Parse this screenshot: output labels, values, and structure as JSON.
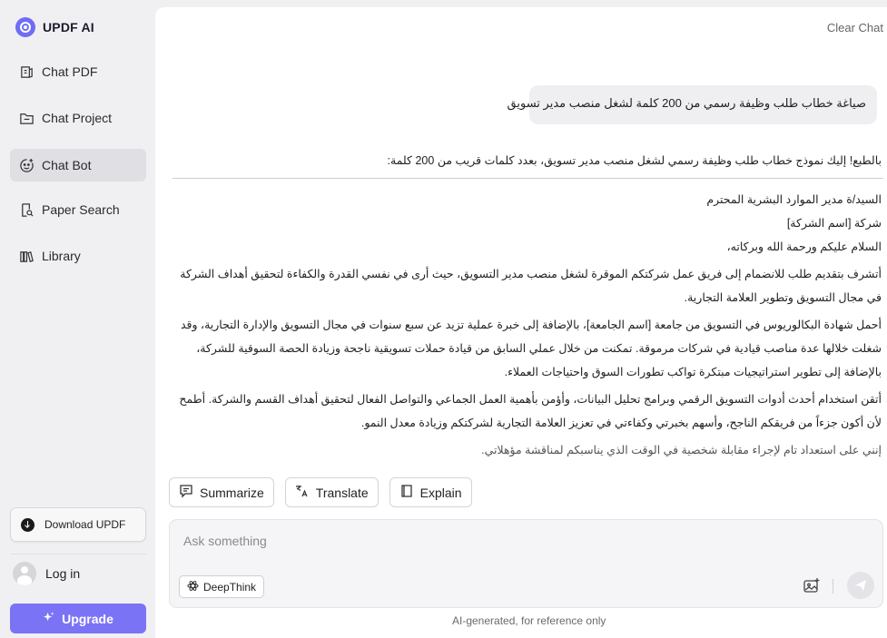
{
  "app": {
    "name": "UPDF AI"
  },
  "sidebar": {
    "items": [
      {
        "label": "Chat PDF",
        "icon": "chat-pdf-icon"
      },
      {
        "label": "Chat Project",
        "icon": "folder-icon"
      },
      {
        "label": "Chat Bot",
        "icon": "bot-icon",
        "active": true
      },
      {
        "label": "Paper Search",
        "icon": "paper-search-icon"
      },
      {
        "label": "Library",
        "icon": "library-icon"
      }
    ],
    "download_label": "Download UPDF",
    "login_label": "Log in",
    "upgrade_label": "Upgrade"
  },
  "header": {
    "clear_chat": "Clear Chat"
  },
  "conversation": {
    "user_message": "صياغة خطاب طلب وظيفة رسمي من 200 كلمة لشغل منصب مدير تسويق",
    "reply_intro": "بالطبع! إليك نموذج خطاب طلب وظيفة رسمي لشغل منصب مدير تسويق، بعدد كلمات قريب من 200 كلمة:",
    "reply_lines": {
      "salutation1": "السيد/ة مدير الموارد البشرية المحترم",
      "salutation2": "شركة [اسم الشركة]",
      "greeting": "السلام عليكم ورحمة الله وبركاته،",
      "para1": "أتشرف بتقديم طلب للانضمام إلى فريق عمل شركتكم الموقرة لشغل منصب مدير التسويق، حيث أرى في نفسي القدرة والكفاءة لتحقيق أهداف الشركة في مجال التسويق وتطوير العلامة التجارية.",
      "para2": "أحمل شهادة البكالوريوس في التسويق من جامعة [اسم الجامعة]، بالإضافة إلى خبرة عملية تزيد عن سبع سنوات في مجال التسويق والإدارة التجارية، وقد شغلت خلالها عدة مناصب قيادية في شركات مرموقة. تمكنت من خلال عملي السابق من قيادة حملات تسويقية ناجحة وزيادة الحصة السوقية للشركة، بالإضافة إلى تطوير استراتيجيات مبتكرة تواكب تطورات السوق واحتياجات العملاء.",
      "para3": "أتقن استخدام أحدث أدوات التسويق الرقمي وبرامج تحليل البيانات، وأؤمن بأهمية العمل الجماعي والتواصل الفعال لتحقيق أهداف القسم والشركة. أطمح لأن أكون جزءاً من فريقكم الناجح، وأسهم بخبرتي وكفاءتي في تعزيز العلامة التجارية لشركتكم وزيادة معدل النمو.",
      "para4_partial": "إنني على استعداد تام لإجراء مقابلة شخصية في الوقت الذي يناسبكم لمناقشة مؤهلاتي."
    }
  },
  "actions": {
    "summarize": "Summarize",
    "translate": "Translate",
    "explain": "Explain"
  },
  "composer": {
    "placeholder": "Ask something",
    "deepthink": "DeepThink"
  },
  "footer": {
    "note": "AI-generated, for reference only"
  },
  "colors": {
    "accent": "#7b73f6",
    "active_nav": "#e0e0e4"
  }
}
